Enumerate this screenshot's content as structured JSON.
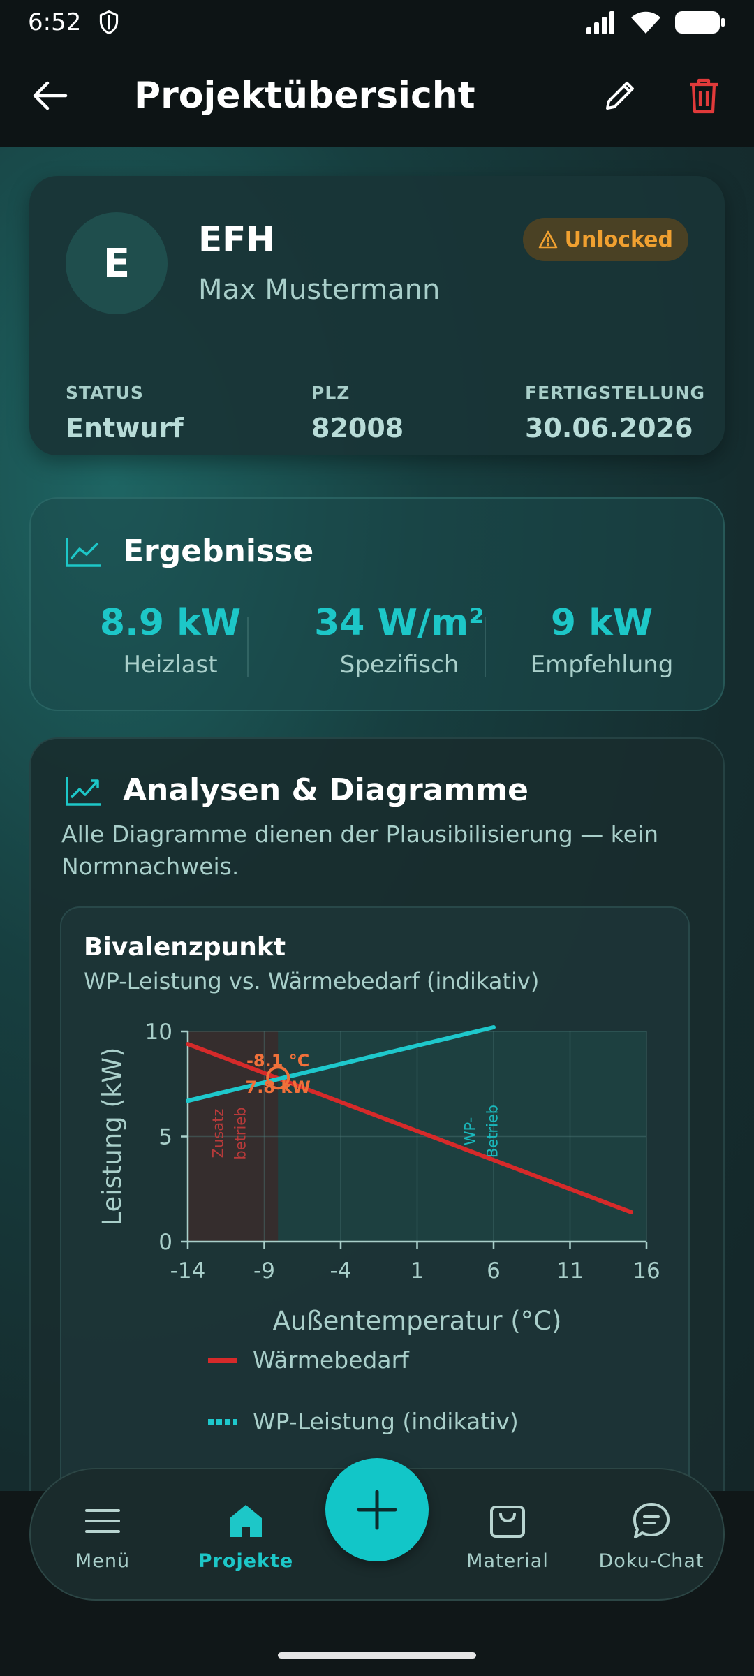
{
  "status_bar": {
    "time": "6:52"
  },
  "app_bar": {
    "title": "Projektübersicht"
  },
  "project": {
    "avatar_letter": "E",
    "name": "EFH",
    "owner": "Max Mustermann",
    "badge": "Unlocked",
    "meta": [
      {
        "label": "STATUS",
        "value": "Entwurf"
      },
      {
        "label": "PLZ",
        "value": "82008"
      },
      {
        "label": "FERTIGSTELLUNG",
        "value": "30.06.2026"
      }
    ]
  },
  "results": {
    "title": "Ergebnisse",
    "items": [
      {
        "value": "8.9 kW",
        "label": "Heizlast"
      },
      {
        "value": "34 W/m²",
        "label": "Spezifisch"
      },
      {
        "value": "9 kW",
        "label": "Empfehlung"
      }
    ]
  },
  "analysis": {
    "title": "Analysen & Diagramme",
    "description": "Alle Diagramme dienen der Plausibilisierung — kein Normnachweis."
  },
  "chart_data": {
    "type": "line",
    "title": "Bivalenzpunkt",
    "subtitle": "WP-Leistung vs. Wärmebedarf (indikativ)",
    "xlabel": "Außentemperatur (°C)",
    "ylabel": "Leistung (kW)",
    "xlim": [
      -14,
      16
    ],
    "ylim": [
      0,
      10
    ],
    "xticks": [
      "-14",
      "-9",
      "-4",
      "1",
      "6",
      "11",
      "16"
    ],
    "yticks": [
      "0",
      "5",
      "10"
    ],
    "grid": true,
    "series": [
      {
        "name": "Wärmebedarf",
        "color": "#d62a2a",
        "style": "solid",
        "x": [
          -14,
          15
        ],
        "y": [
          9.4,
          1.4
        ]
      },
      {
        "name": "WP-Leistung (indikativ)",
        "color": "#1ec8cc",
        "style": "solid",
        "x": [
          -14,
          6
        ],
        "y": [
          6.7,
          10.2
        ]
      }
    ],
    "bivalence_point": {
      "x": -8.1,
      "y": 7.8,
      "label_temp": "-8.1 °C",
      "label_power": "7.8 kW"
    },
    "regions": [
      {
        "label_line1": "Zusatz",
        "label_line2": "betrieb",
        "x_from": -14,
        "x_to": -8.1
      },
      {
        "label_line1": "WP-",
        "label_line2": "Betrieb",
        "x_from": -8.1,
        "x_to": 16
      }
    ]
  },
  "nav": {
    "items": [
      {
        "label": "Menü",
        "icon": "menu-icon"
      },
      {
        "label": "Projekte",
        "icon": "home-icon"
      },
      {
        "label": "Material",
        "icon": "shopping-bag-icon"
      },
      {
        "label": "Doku-Chat",
        "icon": "chat-icon"
      }
    ],
    "fab_icon": "plus-icon"
  },
  "colors": {
    "accent": "#1dc7c8",
    "danger": "#e03a3a",
    "warning": "#f0a030"
  }
}
